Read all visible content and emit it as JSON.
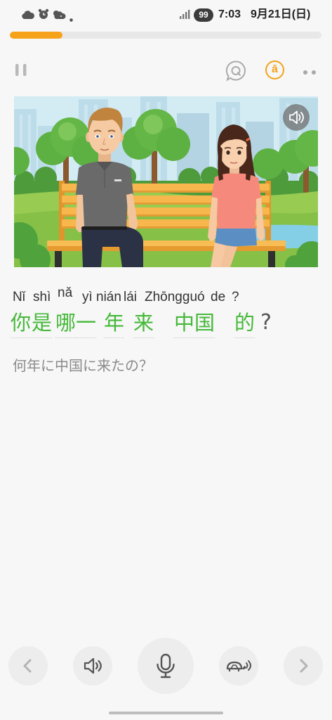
{
  "status_bar": {
    "time": "7:03",
    "date": "9月21日(日)",
    "battery_level": "99",
    "icons": [
      "cloud-icon",
      "alarm-clock-icon",
      "weather-icon",
      "notification-dot-icon",
      "signal-icon"
    ]
  },
  "progress": {
    "fraction": 0.17,
    "fill_color": "#f7a21b",
    "track_color": "#e8e8e8"
  },
  "toolbar": {
    "pause_icon": "pause-icon",
    "question_icon": "q-bubble-icon",
    "pinyin_toggle_label": "ā",
    "pinyin_toggle_color": "#f5a31a",
    "more_icon": "more-icon"
  },
  "scene": {
    "play_audio_icon": "speaker-icon"
  },
  "sentence": {
    "tokens": [
      {
        "pinyin": "Nǐ",
        "hanzi": "你"
      },
      {
        "pinyin": "shì",
        "hanzi": "是"
      },
      {
        "pinyin": "nǎ",
        "hanzi": "哪"
      },
      {
        "pinyin": "yì",
        "hanzi": "一"
      },
      {
        "pinyin": "nián",
        "hanzi": "年"
      },
      {
        "pinyin": "lái",
        "hanzi": "来"
      },
      {
        "pinyin": "Zhōngguó",
        "hanzi": "中国"
      },
      {
        "pinyin": "de",
        "hanzi": "的"
      },
      {
        "pinyin": "?",
        "hanzi": "?"
      }
    ],
    "hanzi_color": "#46b83a",
    "punctuation_color": "#555555",
    "translation": "何年に中国に来たの？"
  },
  "controls": {
    "previous_icon": "chevron-left-icon",
    "play_icon": "speaker-icon",
    "record_icon": "microphone-icon",
    "slow_play_icon": "turtle-speaker-icon",
    "next_icon": "chevron-right-icon"
  }
}
